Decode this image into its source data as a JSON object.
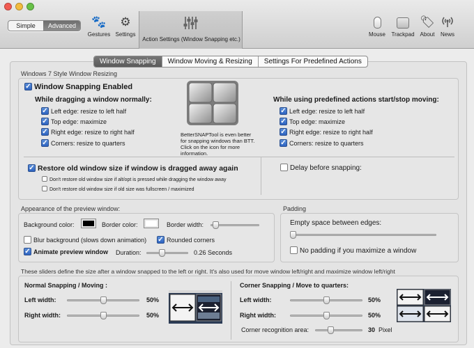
{
  "toolbar": {
    "mode_simple": "Simple",
    "mode_advanced": "Advanced",
    "gestures": "Gestures",
    "settings": "Settings",
    "action_settings": "Action Settings (Window Snapping etc.)",
    "mouse": "Mouse",
    "trackpad": "Trackpad",
    "about": "About",
    "news": "News"
  },
  "tabs": [
    "Window Snapping",
    "Window Moving & Resizing",
    "Settings For Predefined Actions"
  ],
  "resizing": {
    "section": "Windows 7 Style Window Resizing",
    "enabled_label": "Window Snapping Enabled",
    "dragging_title": "While dragging a window normally:",
    "dragging_items": [
      "Left edge: resize to left half",
      "Top edge: maximize",
      "Right edge: resize to right half",
      "Corners: resize to quarters"
    ],
    "predefined_title": "While using predefined actions start/stop moving:",
    "predefined_items": [
      "Left edge: resize to left half",
      "Top edge: maximize",
      "Right edge: resize to right half",
      "Corners: resize to quarters"
    ],
    "bettersnap_note": "BetterSNAPTool is even better for snapping windows than BTT. Click on the icon for more information.",
    "restore_label": "Restore old window size if window is dragged away again",
    "restore_alt": "Don't restore old window size if alt/opt is pressed while dragging the window away",
    "restore_fullscreen": "Don't restore old window size if old size was fullscreen / maximized",
    "delay_label": "Delay before snapping:"
  },
  "preview": {
    "section": "Appearance of the preview window:",
    "bg_color_label": "Background color:",
    "bg_color": "#000000",
    "border_color_label": "Border color:",
    "border_color": "#ffffff",
    "border_width_label": "Border width:",
    "border_width_level": 0.05,
    "blur_label": "Blur background (slows down animation)",
    "rounded_label": "Rounded corners",
    "animate_label": "Animate preview window",
    "duration_label": "Duration:",
    "duration_level": 0.35,
    "duration_value": "0.26 Seconds"
  },
  "padding": {
    "section": "Padding",
    "empty_space_label": "Empty space between edges:",
    "empty_space_level": 0.0,
    "no_padding_label": "No padding if you maximize a window"
  },
  "sizes": {
    "description": "These sliders define the size after a window snapped to the left or right. It's also used for move window left/right and maximize window left/right",
    "normal_title": "Normal Snapping / Moving :",
    "left_width_label": "Left width:",
    "left_width_value": "50%",
    "right_width_label": "Right width:",
    "right_width_value": "50%",
    "corner_title": "Corner Snapping / Move to quarters:",
    "corner_left_label": "Left width:",
    "corner_left_value": "50%",
    "corner_right_label": "Right width:",
    "corner_right_value": "50%",
    "corner_area_label": "Corner recognition area:",
    "corner_area_value": "30",
    "corner_area_unit": "Pixel"
  },
  "colors": {
    "accent": "#2d63c0",
    "selected_tab": "#5a5a5a"
  }
}
